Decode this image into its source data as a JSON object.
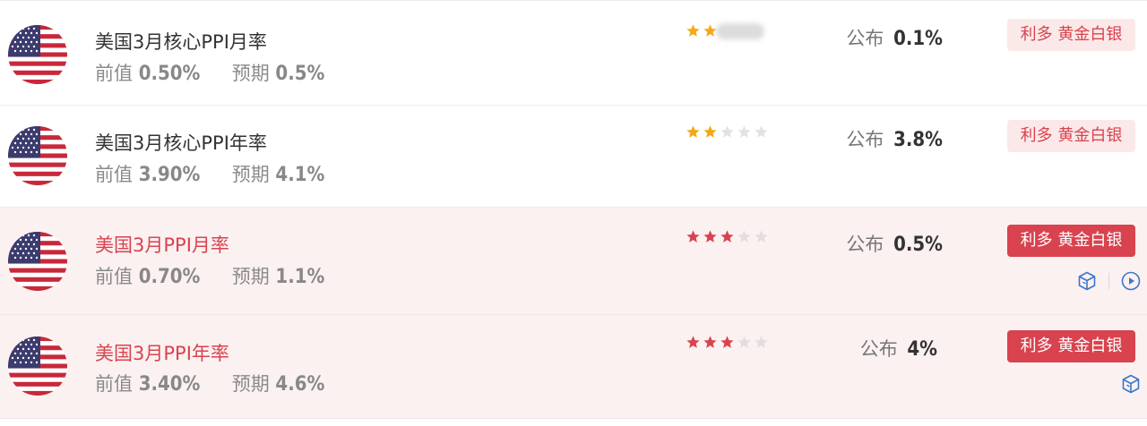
{
  "colors": {
    "accent_red": "#d8434f",
    "star_gold": "#f4a816",
    "star_red": "#d8434f",
    "star_empty": "#dddddd",
    "icon_blue": "#3a76d0"
  },
  "items": [
    {
      "title": "美国3月核心PPI月率",
      "prev_label": "前值",
      "prev_value": "0.50%",
      "forecast_label": "预期",
      "forecast_value": "0.5%",
      "publish_label": "公布",
      "publish_value": "0.1%",
      "tag": "利多 黄金白银",
      "importance": 2,
      "importance_max": 5,
      "highlight": false,
      "icons": []
    },
    {
      "title": "美国3月核心PPI年率",
      "prev_label": "前值",
      "prev_value": "3.90%",
      "forecast_label": "预期",
      "forecast_value": "4.1%",
      "publish_label": "公布",
      "publish_value": "3.8%",
      "tag": "利多 黄金白银",
      "importance": 2,
      "importance_max": 5,
      "highlight": false,
      "icons": []
    },
    {
      "title": "美国3月PPI月率",
      "prev_label": "前值",
      "prev_value": "0.70%",
      "forecast_label": "预期",
      "forecast_value": "1.1%",
      "publish_label": "公布",
      "publish_value": "0.5%",
      "tag": "利多 黄金白银",
      "importance": 3,
      "importance_max": 5,
      "highlight": true,
      "icons": [
        "cube-icon",
        "play-icon"
      ]
    },
    {
      "title": "美国3月PPI年率",
      "prev_label": "前值",
      "prev_value": "3.40%",
      "forecast_label": "预期",
      "forecast_value": "4.6%",
      "publish_label": "公布",
      "publish_value": "4%",
      "tag": "利多 黄金白银",
      "importance": 3,
      "importance_max": 5,
      "highlight": true,
      "icons": [
        "cube-icon"
      ]
    }
  ]
}
